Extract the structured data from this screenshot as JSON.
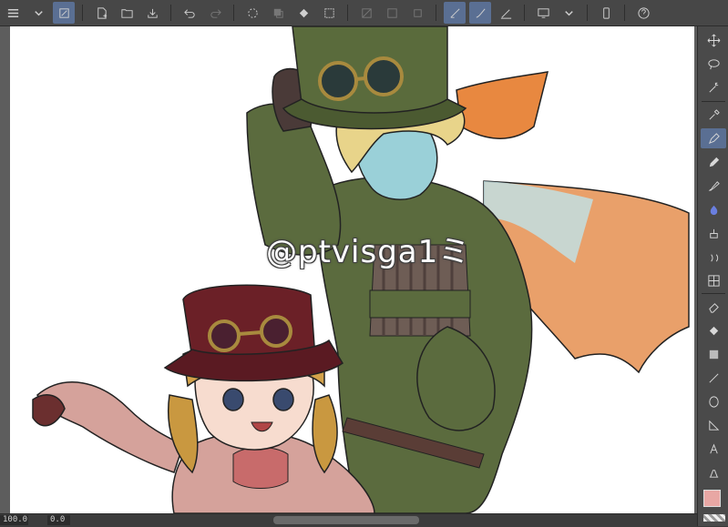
{
  "toolbar": {
    "items": [
      {
        "name": "menu-icon"
      },
      {
        "name": "chevron-down-icon"
      },
      {
        "name": "quick-access-icon"
      },
      {
        "name": "new-file-icon"
      },
      {
        "name": "open-folder-icon"
      },
      {
        "name": "save-icon"
      },
      {
        "name": "undo-icon"
      },
      {
        "name": "redo-icon"
      },
      {
        "name": "loading-icon"
      },
      {
        "name": "clear-icon"
      },
      {
        "name": "fill-icon"
      },
      {
        "name": "crop-icon"
      },
      {
        "name": "deselect-icon"
      },
      {
        "name": "invert-selection-icon"
      },
      {
        "name": "transform-icon"
      },
      {
        "name": "stabilize-icon"
      },
      {
        "name": "pen-correction-icon"
      },
      {
        "name": "pen-pressure-icon"
      },
      {
        "name": "display-icon"
      },
      {
        "name": "device-icon"
      },
      {
        "name": "help-icon"
      }
    ]
  },
  "canvas": {
    "watermark": "@ptvisga1ミ"
  },
  "tools": {
    "active": "pen",
    "items": [
      "move",
      "lasso",
      "magic-wand",
      "eyedropper",
      "pen",
      "pencil",
      "brush",
      "airbrush",
      "decoration",
      "blend",
      "frame",
      "eraser",
      "fill",
      "gradient",
      "line",
      "shape",
      "ruler",
      "text",
      "balloon",
      "correction"
    ]
  },
  "colors": {
    "main": "#e8a7a4",
    "sub": "#111111",
    "accent": "#5a6f93"
  },
  "status": {
    "zoom": "100.0",
    "rotation": "0.0"
  }
}
